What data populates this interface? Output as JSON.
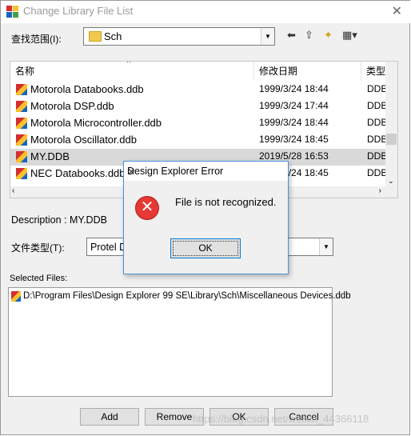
{
  "window": {
    "title": "Change Library File List",
    "close_glyph": "✕"
  },
  "lookin": {
    "label": "查找范围(I):",
    "value": "Sch"
  },
  "toolbar": {
    "back": "⬅",
    "up": "⇧",
    "new_folder": "✦",
    "view": "▦▾"
  },
  "list": {
    "columns": [
      "名称",
      "修改日期",
      "类型"
    ],
    "rows": [
      {
        "name": "Motorola Databooks.ddb",
        "date": "1999/3/24 18:44",
        "type": "DDB"
      },
      {
        "name": "Motorola DSP.ddb",
        "date": "1999/3/24 17:44",
        "type": "DDB"
      },
      {
        "name": "Motorola Microcontroller.ddb",
        "date": "1999/3/24 18:44",
        "type": "DDB"
      },
      {
        "name": "Motorola Oscillator.ddb",
        "date": "1999/3/24 18:45",
        "type": "DDB"
      },
      {
        "name": "MY.DDB",
        "date": "2019/5/28 16:53",
        "type": "DDB"
      },
      {
        "name": "NEC Databooks.ddb",
        "date": "1999/3/24 18:45",
        "type": "DDB"
      }
    ]
  },
  "description": {
    "label": "Description : MY.DDB"
  },
  "filetype": {
    "label": "文件类型(T):",
    "value": "Protel D"
  },
  "selected": {
    "label": "Selected Files:",
    "path": "D:\\Program Files\\Design Explorer 99 SE\\Library\\Sch\\Miscellaneous Devices.ddb"
  },
  "buttons": {
    "add": "Add",
    "remove": "Remove",
    "ok": "OK",
    "cancel": "Cancel"
  },
  "dialog": {
    "title": "Design Explorer Error",
    "message": "File is not recognized.",
    "ok": "OK",
    "close_glyph": "✕",
    "icon_glyph": "✕"
  },
  "watermark": "https://blog.csdn.net/weixin_44366118"
}
